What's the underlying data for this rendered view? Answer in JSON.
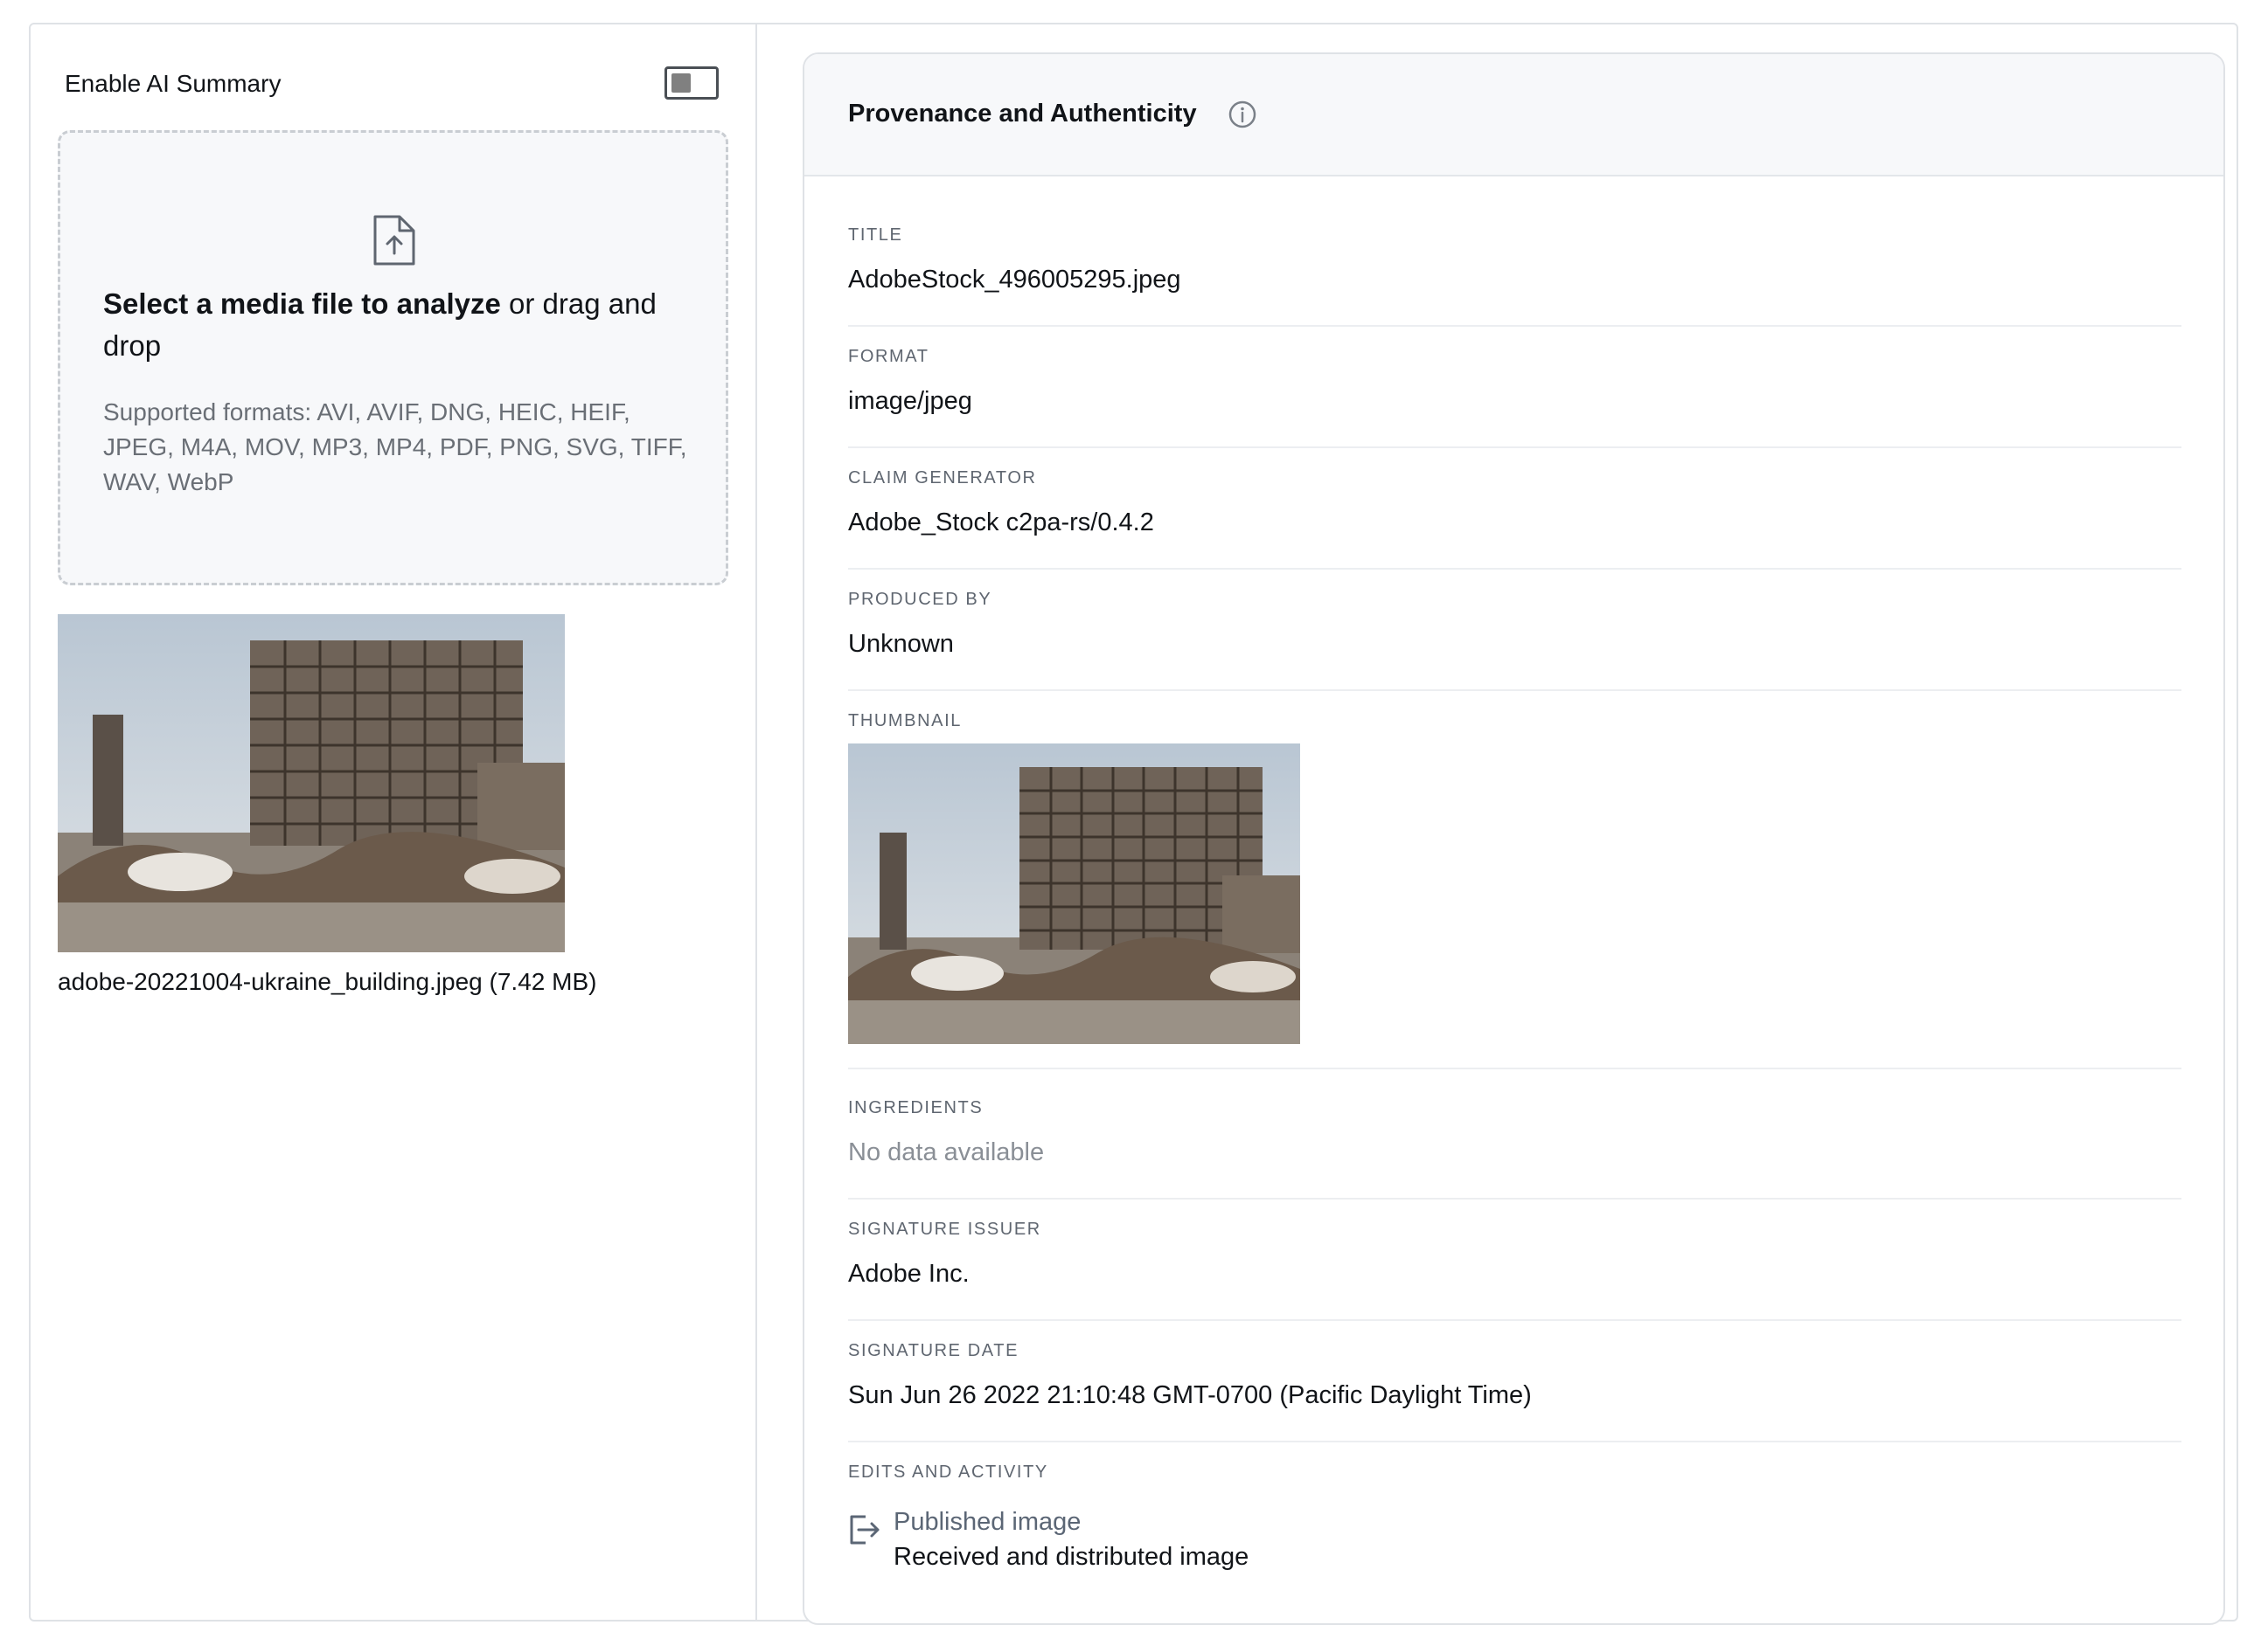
{
  "ai_summary": {
    "label": "Enable AI Summary",
    "enabled": false
  },
  "dropzone": {
    "main_bold": "Select a media file to analyze",
    "main_rest": " or drag and drop",
    "formats": "Supported formats: AVI, AVIF, DNG, HEIC, HEIF, JPEG, M4A, MOV, MP3, MP4, PDF, PNG, SVG, TIFF, WAV, WebP",
    "icon": "file-upload-icon"
  },
  "file": {
    "caption": "adobe-20221004-ukraine_building.jpeg (7.42 MB)"
  },
  "panel": {
    "title": "Provenance and Authenticity",
    "info_icon": "info-icon",
    "fields": {
      "title": {
        "label": "TITLE",
        "value": "AdobeStock_496005295.jpeg"
      },
      "format": {
        "label": "FORMAT",
        "value": "image/jpeg"
      },
      "claim_generator": {
        "label": "CLAIM GENERATOR",
        "value": "Adobe_Stock c2pa-rs/0.4.2"
      },
      "produced_by": {
        "label": "PRODUCED BY",
        "value": "Unknown"
      },
      "thumbnail": {
        "label": "THUMBNAIL"
      },
      "ingredients": {
        "label": "INGREDIENTS",
        "value": "No data available"
      },
      "signature_issuer": {
        "label": "SIGNATURE ISSUER",
        "value": "Adobe Inc."
      },
      "signature_date": {
        "label": "SIGNATURE DATE",
        "value": "Sun Jun 26 2022 21:10:48 GMT-0700 (Pacific Daylight Time)"
      },
      "edits": {
        "label": "EDITS AND ACTIVITY",
        "items": [
          {
            "icon": "publish-icon",
            "title": "Published image",
            "description": "Received and distributed image"
          }
        ]
      }
    }
  }
}
